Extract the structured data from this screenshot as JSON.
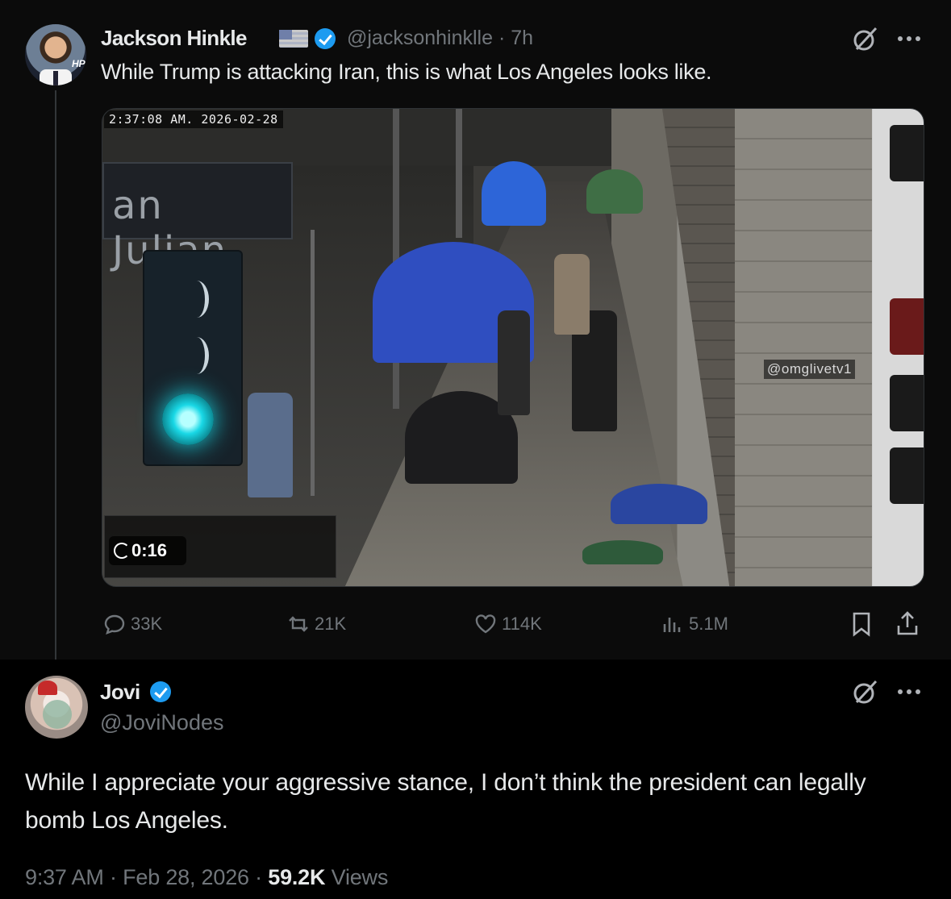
{
  "parent_post": {
    "author_name": "Jackson Hinkle",
    "avatar_tag": "HP",
    "handle": "@jacksonhinklle",
    "separator": "·",
    "age": "7h",
    "text": "While Trump is attacking Iran, this is what Los Angeles looks like.",
    "media": {
      "timestamp_overlay": "2:37:08 AM.  2026-02-28",
      "street_sign": "an Julian",
      "watermark": "@omglivetv1",
      "duration": "0:16"
    },
    "actions": {
      "replies": "33K",
      "reposts": "21K",
      "likes": "114K",
      "views": "5.1M"
    }
  },
  "reply_post": {
    "author_name": "Jovi",
    "handle": "@JoviNodes",
    "text": "While I appreciate your aggressive stance, I don’t think the president can legally bomb Los Angeles.",
    "time": "9:37 AM",
    "sep1": "·",
    "date": "Feb 28, 2026",
    "sep2": "·",
    "views_count": "59.2K",
    "views_label": "Views"
  },
  "icons": {
    "verified": "verified-badge-icon",
    "grok": "grok-icon",
    "more": "more-icon",
    "reply": "reply-icon",
    "repost": "repost-icon",
    "like": "like-icon",
    "views": "views-icon",
    "bookmark": "bookmark-icon",
    "share": "share-icon"
  },
  "colors": {
    "background": "#000000",
    "parent_background": "#0b0b0b",
    "text_primary": "#e7e9ea",
    "text_secondary": "#71767b",
    "verified_blue": "#1d9bf0"
  }
}
